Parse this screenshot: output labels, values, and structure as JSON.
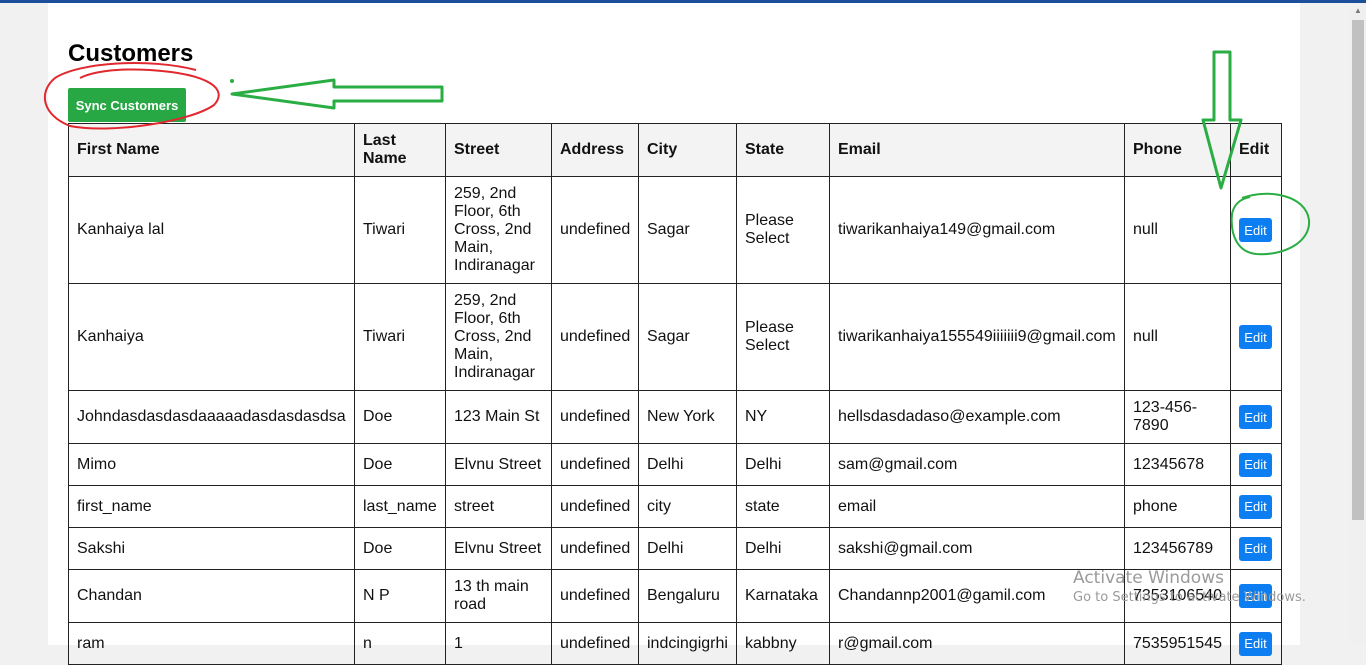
{
  "page": {
    "title": "Customers",
    "sync_button": "Sync Customers"
  },
  "table": {
    "headers": [
      "First Name",
      "Last Name",
      "Street",
      "Address",
      "City",
      "State",
      "Email",
      "Phone",
      "Edit"
    ],
    "rows": [
      [
        "Kanhaiya lal",
        "Tiwari",
        "259, 2nd Floor, 6th Cross, 2nd Main, Indiranagar",
        "undefined",
        "Sagar",
        "Please Select",
        "tiwarikanhaiya149@gmail.com",
        "null"
      ],
      [
        "Kanhaiya",
        "Tiwari",
        "259, 2nd Floor, 6th Cross, 2nd Main, Indiranagar",
        "undefined",
        "Sagar",
        "Please Select",
        "tiwarikanhaiya155549iiiiiii9@gmail.com",
        "null"
      ],
      [
        "Johndasdasdasdaaaaadasdasdasdsa",
        "Doe",
        "123 Main St",
        "undefined",
        "New York",
        "NY",
        "hellsdasdadaso@example.com",
        "123-456-7890"
      ],
      [
        "Mimo",
        "Doe",
        "Elvnu Street",
        "undefined",
        "Delhi",
        "Delhi",
        "sam@gmail.com",
        "12345678"
      ],
      [
        "first_name",
        "last_name",
        "street",
        "undefined",
        "city",
        "state",
        "email",
        "phone"
      ],
      [
        "Sakshi",
        "Doe",
        "Elvnu Street",
        "undefined",
        "Delhi",
        "Delhi",
        "sakshi@gmail.com",
        "123456789"
      ],
      [
        "Chandan",
        "N P",
        "13 th main road",
        "undefined",
        "Bengaluru",
        "Karnataka",
        "Chandannp2001@gamil.com",
        "7353106540"
      ],
      [
        "ram",
        "n",
        "1",
        "undefined",
        "indcingigrhi",
        "kabbny",
        "r@gmail.com",
        "7535951545"
      ]
    ],
    "edit_label": "Edit"
  },
  "watermark": {
    "title": "Activate Windows",
    "subtitle": "Go to Settings to activate Windows."
  },
  "colors": {
    "sync_button": "#28a745",
    "edit_button": "#0d7ef2",
    "annotation_red": "#e0282e",
    "annotation_green": "#2aae43",
    "top_accent": "#1b4f9c"
  }
}
